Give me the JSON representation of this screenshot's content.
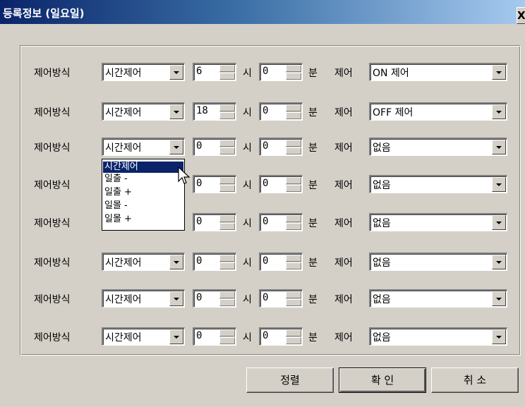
{
  "window": {
    "title": "등록정보 (일요일)",
    "close_label": "X"
  },
  "labels": {
    "method": "제어방식",
    "hour": "시",
    "minute": "분",
    "control": "제어"
  },
  "rows": [
    {
      "method": "시간제어",
      "hour": "6",
      "minute": "0",
      "control": "ON 제어"
    },
    {
      "method": "시간제어",
      "hour": "18",
      "minute": "0",
      "control": "OFF 제어"
    },
    {
      "method": "시간제어",
      "hour": "0",
      "minute": "0",
      "control": "없음"
    },
    {
      "method": "",
      "hour": "0",
      "minute": "0",
      "control": "없음"
    },
    {
      "method": "",
      "hour": "0",
      "minute": "0",
      "control": "없음"
    },
    {
      "method": "시간제어",
      "hour": "0",
      "minute": "0",
      "control": "없음"
    },
    {
      "method": "시간제어",
      "hour": "0",
      "minute": "0",
      "control": "없음"
    },
    {
      "method": "시간제어",
      "hour": "0",
      "minute": "0",
      "control": "없음"
    }
  ],
  "dropdown": {
    "options": [
      "시간제어",
      "일출 -",
      "일출 +",
      "일몰 -",
      "일몰 +"
    ],
    "selected": "시간제어"
  },
  "buttons": {
    "sort": "정렬",
    "ok": "확 인",
    "cancel": "취 소"
  }
}
